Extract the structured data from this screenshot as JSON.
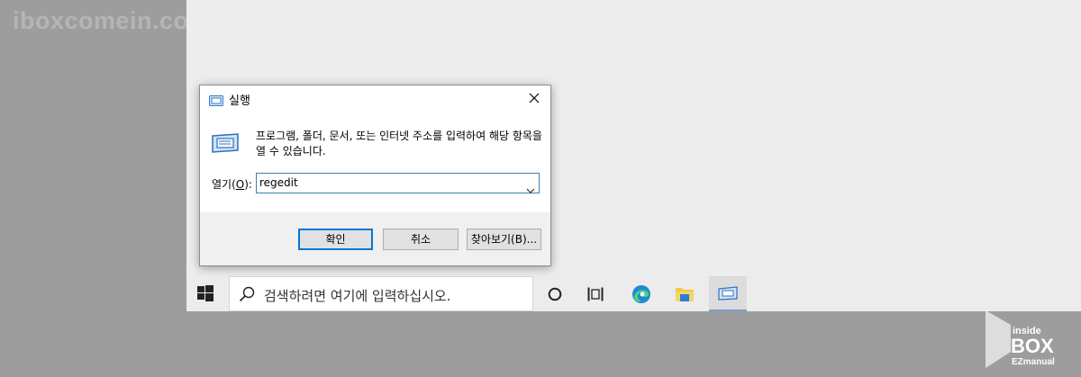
{
  "watermark": "iboxcomein.com",
  "run_dialog": {
    "title": "실행",
    "description": "프로그램, 폴더, 문서, 또는 인터넷 주소를 입력하여 해당 항목을 열 수 있습니다.",
    "open_label_prefix": "열기(",
    "open_label_mnemonic": "O",
    "open_label_suffix": "):",
    "open_value": "regedit",
    "ok_label": "확인",
    "cancel_label": "취소",
    "browse_label": "찾아보기(B)..."
  },
  "taskbar": {
    "search_placeholder": "검색하려면 여기에 입력하십시오.",
    "items": [
      "start-icon",
      "search-icon",
      "cortana-icon",
      "task-view-icon",
      "edge-icon",
      "file-explorer-icon",
      "run-icon"
    ]
  },
  "logo": {
    "text_top": "inside",
    "text_main": "BOX",
    "text_bottom": "EZmanual"
  },
  "colors": {
    "accent": "#0078d7",
    "background": "#9d9d9d",
    "desktop": "#ededed"
  }
}
